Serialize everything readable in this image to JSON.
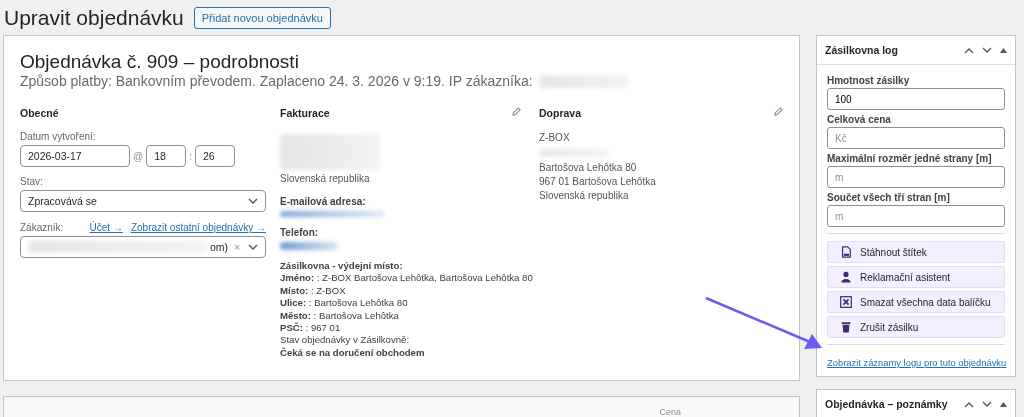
{
  "page_title": "Upravit objednávku",
  "add_button": "Přidat novou objednávku",
  "order": {
    "heading": "Objednávka č. 909 – podrobnosti",
    "meta": "Způsob platby: Bankovním převodem. Zaplaceno 24. 3. 2026 v 9:19. IP zákazníka:",
    "general": {
      "heading": "Obecné",
      "date_label": "Datum vytvoření:",
      "date": "2026-03-17",
      "at": "@",
      "hour": "18",
      "colon": ":",
      "minute": "26",
      "status_label": "Stav:",
      "status": "Zpracovává se",
      "customer_label": "Zákazník:",
      "links": [
        "Účet →",
        "Zobrazit ostatní objednávky →"
      ],
      "customer_value": "om)",
      "clear": "×"
    },
    "billing": {
      "heading": "Fakturace",
      "country": "Slovenská republika",
      "email_label": "E-mailová adresa:",
      "phone_label": "Telefon:",
      "pickup_lines": [
        {
          "kind": "heading",
          "text": "Zásilkovna - výdejní místo:"
        },
        {
          "kind": "field",
          "text": "**Jméno:** : Z-BOX Bartošova Lehôtka, Bartošova Lehôtka 80"
        },
        {
          "kind": "field",
          "text": "**Místo:** : Z-BOX"
        },
        {
          "kind": "field",
          "text": "**Ulice:** : Bartošova Lehôtka 80"
        },
        {
          "kind": "field",
          "text": "**Město:** : Bartošova Lehôtka"
        },
        {
          "kind": "field",
          "text": "**PSČ:** : 967 01"
        },
        {
          "kind": "plain",
          "text": "Stav objednávky v Zásilkovně:"
        },
        {
          "kind": "heading",
          "text": "Čeká se na doručení obchodem"
        }
      ]
    },
    "shipping": {
      "heading": "Doprava",
      "name": "Z-BOX",
      "lines": [
        "Bartošova Lehôtka 80",
        "967 01 Bartošova Lehôtka",
        "Slovenská republika"
      ]
    }
  },
  "items": {
    "columns": [
      "Cena"
    ]
  },
  "sidebar": {
    "log_panel": {
      "title": "Zásilkovna log",
      "fields": [
        {
          "label": "Hmotnost zásilky",
          "value": "100"
        },
        {
          "label": "Celková cena",
          "placeholder": "Kč"
        },
        {
          "label": "Maximální rozměr jedné strany [m]",
          "placeholder": "m"
        },
        {
          "label": "Součet všech tří stran [m]",
          "placeholder": "m"
        }
      ],
      "actions": [
        {
          "kind": "label",
          "label": "Stáhnout štítek"
        },
        {
          "kind": "claim",
          "label": "Reklamační asistent"
        },
        {
          "kind": "delete",
          "label": "Smazat všechna data balíčku"
        },
        {
          "kind": "cancel",
          "label": "Zrušit zásilku"
        }
      ],
      "log_link": "Zobrazit záznamy logu pro tuto objednávku"
    },
    "notes_panel": {
      "title": "Objednávka – poznámky"
    }
  }
}
